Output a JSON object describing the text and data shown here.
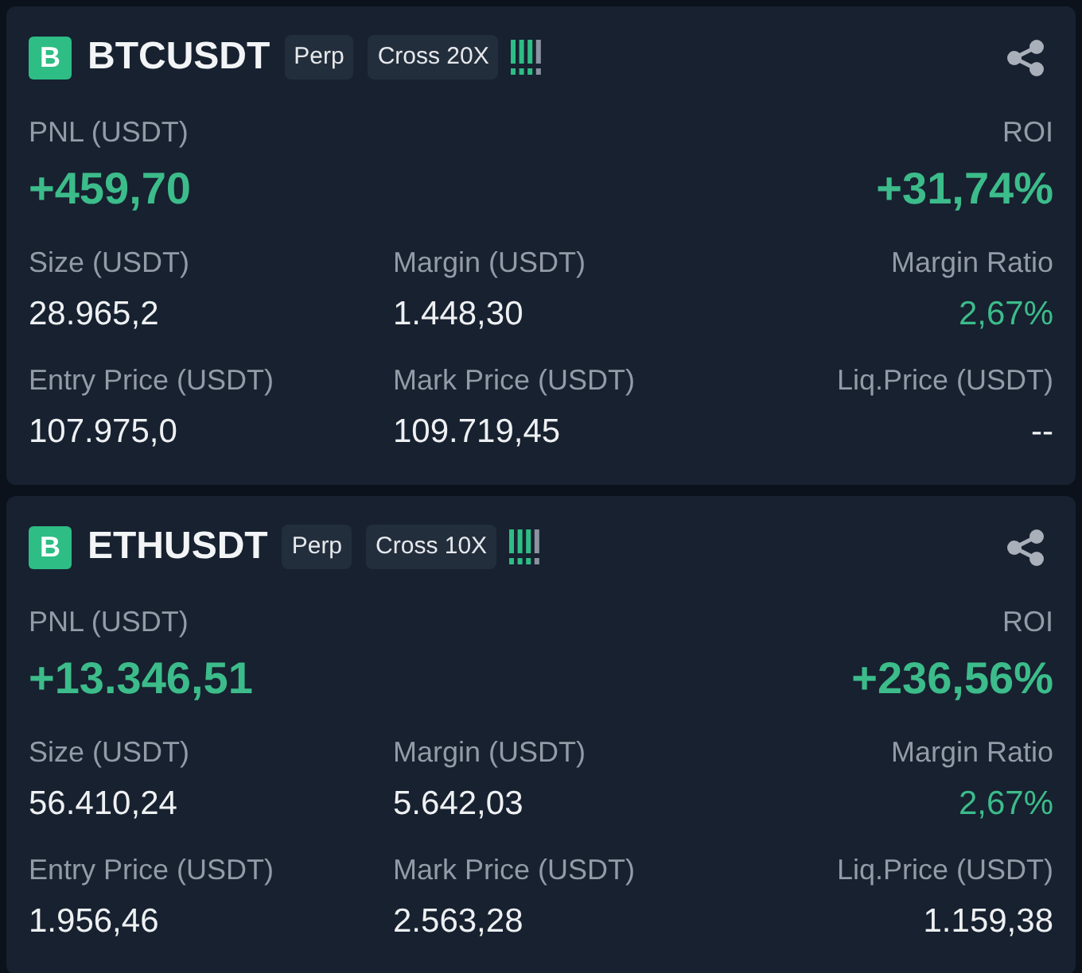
{
  "positions": [
    {
      "side_badge": "B",
      "symbol": "BTCUSDT",
      "tags": [
        "Perp",
        "Cross 20X"
      ],
      "pnl": {
        "label": "PNL (USDT)",
        "value": "+459,70"
      },
      "roi": {
        "label": "ROI",
        "value": "+31,74%"
      },
      "fields": [
        {
          "label": "Size (USDT)",
          "value": "28.965,2",
          "kind": "plain"
        },
        {
          "label": "Margin (USDT)",
          "value": "1.448,30",
          "kind": "plain"
        },
        {
          "label": "Margin Ratio",
          "value": "2,67%",
          "kind": "positive"
        },
        {
          "label": "Entry Price (USDT)",
          "value": "107.975,0",
          "kind": "plain"
        },
        {
          "label": "Mark Price (USDT)",
          "value": "109.719,45",
          "kind": "plain"
        },
        {
          "label": "Liq.Price (USDT)",
          "value": "--",
          "kind": "plain"
        }
      ]
    },
    {
      "side_badge": "B",
      "symbol": "ETHUSDT",
      "tags": [
        "Perp",
        "Cross 10X"
      ],
      "pnl": {
        "label": "PNL (USDT)",
        "value": "+13.346,51"
      },
      "roi": {
        "label": "ROI",
        "value": "+236,56%"
      },
      "fields": [
        {
          "label": "Size (USDT)",
          "value": "56.410,24",
          "kind": "plain"
        },
        {
          "label": "Margin (USDT)",
          "value": "5.642,03",
          "kind": "plain"
        },
        {
          "label": "Margin Ratio",
          "value": "2,67%",
          "kind": "positive"
        },
        {
          "label": "Entry Price (USDT)",
          "value": "1.956,46",
          "kind": "plain"
        },
        {
          "label": "Mark Price (USDT)",
          "value": "2.563,28",
          "kind": "plain"
        },
        {
          "label": "Liq.Price (USDT)",
          "value": "1.159,38",
          "kind": "plain"
        }
      ]
    }
  ]
}
